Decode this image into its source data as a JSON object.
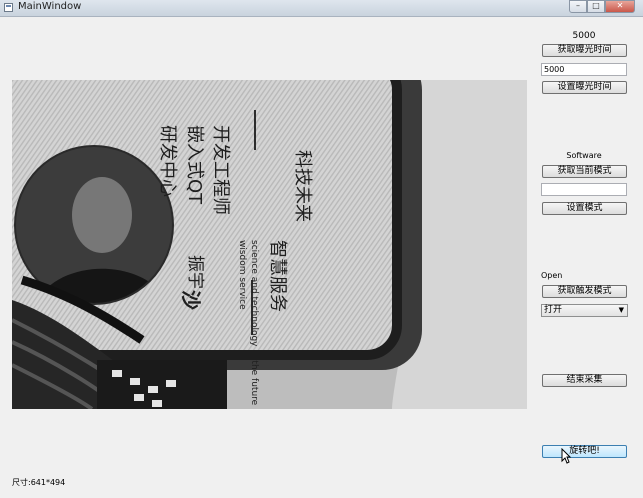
{
  "window": {
    "title": "MainWindow",
    "controls": [
      "min",
      "max",
      "close"
    ]
  },
  "exposure": {
    "value_label": "5000",
    "get_button": "获取曝光时间",
    "input_value": "5000",
    "set_button": "设置曝光时间"
  },
  "mode": {
    "value_label": "Software",
    "get_button": "获取当前模式",
    "input_value": "",
    "set_button": "设置模式"
  },
  "trigger": {
    "value_label": "Open",
    "get_button": "获取触发模式",
    "select_value": "打开"
  },
  "actions": {
    "stop_button": "结束采集",
    "rotate_button": "旋转吧!"
  },
  "status": {
    "size_text": "尺寸:641*494"
  },
  "camera_image": {
    "card_text": {
      "line1": "研发中心",
      "line2": "嵌入式QT",
      "line3": "开发工程师",
      "name_surname": "沙",
      "name_given": "振宇",
      "slogan_en1": "wisdom service",
      "slogan_en2": "science and technology in the future",
      "slogan_cn1": "智慧服务",
      "slogan_cn2": "科技未来"
    }
  },
  "colors": {
    "accent_button": "#bee6fd",
    "window_bg": "#f0f0f0",
    "title_bar": "#c9d3de"
  }
}
